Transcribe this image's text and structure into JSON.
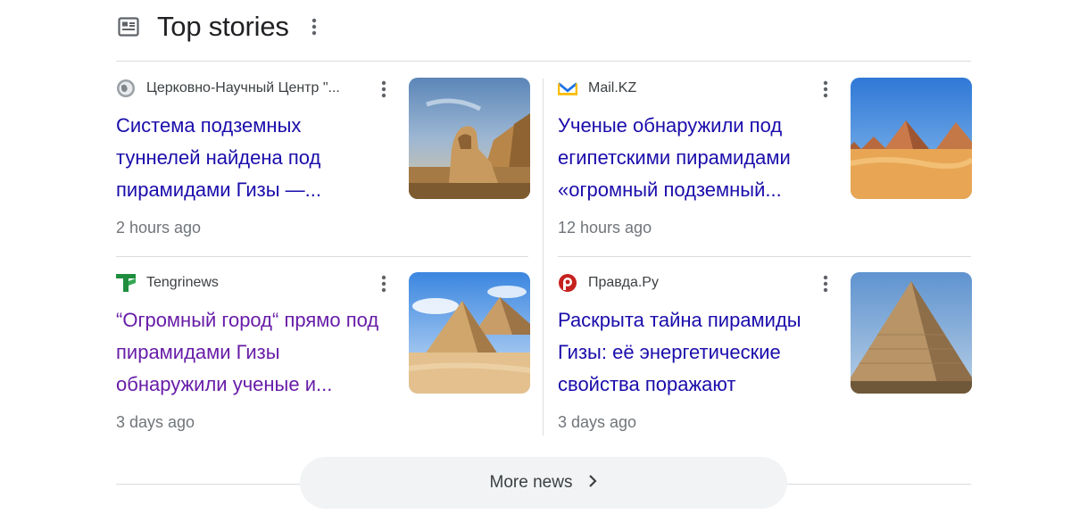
{
  "section": {
    "title": "Top stories",
    "icon": "newspaper-icon",
    "more_label": "More news"
  },
  "stories": [
    {
      "source": "Церковно-Научный Центр \"...",
      "favicon": "globe-icon",
      "headline": "Система подземных туннелей найдена под пирамидами Гизы —...",
      "time": "2 hours ago",
      "image": "sphinx-and-pyramid"
    },
    {
      "source": "Mail.KZ",
      "favicon": "mail-icon",
      "headline": "Ученые обнаружили под египетскими пирамидами «огромный подземный...",
      "time": "12 hours ago",
      "image": "pyramids-in-desert"
    },
    {
      "source": "Tengrinews",
      "favicon": "tengrinews-logo-icon",
      "headline": "“Огромный город“ прямо под пирамидами Гизы обнаружили ученые и...",
      "time": "3 days ago",
      "image": "two-pyramids-sky",
      "visited": true
    },
    {
      "source": "Правда.Ру",
      "favicon": "pravda-logo-icon",
      "headline": "Раскрыта тайна пирамиды Гизы: её энергетические свойства поражают",
      "time": "3 days ago",
      "image": "great-pyramid-closeup"
    }
  ],
  "colors": {
    "link": "#1a0dab",
    "visited_link": "#681da8",
    "meta": "#70757a",
    "divider": "#dadce0",
    "button_bg": "#f1f3f4"
  }
}
